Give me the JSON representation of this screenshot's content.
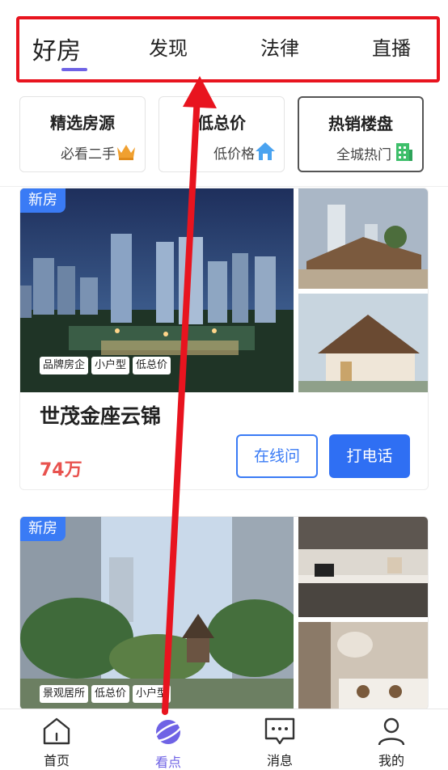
{
  "tabs": [
    {
      "label": "好房",
      "active": true
    },
    {
      "label": "发现",
      "active": false
    },
    {
      "label": "法律",
      "active": false
    },
    {
      "label": "直播",
      "active": false
    }
  ],
  "categories": [
    {
      "title": "精选房源",
      "subtitle": "必看二手",
      "icon": "crown-icon"
    },
    {
      "title": "低总价",
      "subtitle": "低价格",
      "icon": "house-icon"
    },
    {
      "title": "热销楼盘",
      "subtitle": "全城热门",
      "icon": "building-icon"
    }
  ],
  "listings": [
    {
      "badge": "新房",
      "tags": [
        "品牌房企",
        "小户型",
        "低总价"
      ],
      "title": "世茂金座云锦",
      "price": "74万",
      "btn_online": "在线问",
      "btn_call": "打电话"
    },
    {
      "badge": "新房",
      "tags": [
        "景观居所",
        "低总价",
        "小户型"
      ]
    }
  ],
  "nav": [
    {
      "label": "首页",
      "icon": "home-icon",
      "active": false
    },
    {
      "label": "看点",
      "icon": "planet-icon",
      "active": true
    },
    {
      "label": "消息",
      "icon": "message-icon",
      "active": false
    },
    {
      "label": "我的",
      "icon": "user-icon",
      "active": false
    }
  ],
  "colors": {
    "accent": "#6f63e5",
    "primary": "#2f6ff3",
    "price": "#e8524e",
    "annotation": "#e8141f"
  }
}
